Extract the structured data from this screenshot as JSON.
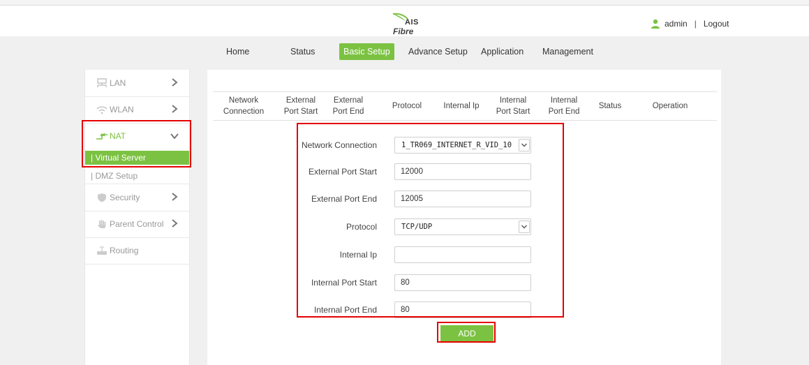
{
  "brand": {
    "top": "AIS",
    "bottom": "Fibre"
  },
  "user": {
    "name": "admin",
    "separator": "|",
    "logout": "Logout"
  },
  "nav": {
    "tabs": [
      {
        "label": "Home"
      },
      {
        "label": "Status"
      },
      {
        "label": "Basic Setup"
      },
      {
        "label": "Advance Setup"
      },
      {
        "label": "Application"
      },
      {
        "label": "Management"
      }
    ],
    "active": "Basic Setup"
  },
  "sidebar": {
    "items": [
      {
        "label": "LAN",
        "icon": "lan-icon"
      },
      {
        "label": "WLAN",
        "icon": "wifi-icon"
      },
      {
        "label": "NAT",
        "icon": "nat-arrows-icon"
      },
      {
        "label": "Security",
        "icon": "shield-icon"
      },
      {
        "label": "Parent Control",
        "icon": "hand-icon"
      },
      {
        "label": "Routing",
        "icon": "router-icon"
      }
    ],
    "nat_sub": [
      {
        "label": "| Virtual Server"
      },
      {
        "label": "| DMZ Setup"
      }
    ]
  },
  "table": {
    "headers": [
      "Network\nConnection",
      "External\nPort Start",
      "External\nPort End",
      "Protocol",
      "Internal Ip",
      "Internal\nPort Start",
      "Internal\nPort End",
      "Status",
      "Operation"
    ]
  },
  "form": {
    "network_connection": {
      "label": "Network Connection",
      "value": "1_TR069_INTERNET_R_VID_10"
    },
    "external_port_start": {
      "label": "External Port Start",
      "value": "12000"
    },
    "external_port_end": {
      "label": "External Port End",
      "value": "12005"
    },
    "protocol": {
      "label": "Protocol",
      "value": "TCP/UDP"
    },
    "internal_ip": {
      "label": "Internal Ip",
      "value": ""
    },
    "internal_port_start": {
      "label": "Internal Port Start",
      "value": "80"
    },
    "internal_port_end": {
      "label": "Internal Port End",
      "value": "80"
    },
    "add_button": "ADD"
  },
  "colors": {
    "accent": "#7cc242",
    "highlight": "#e60000"
  }
}
